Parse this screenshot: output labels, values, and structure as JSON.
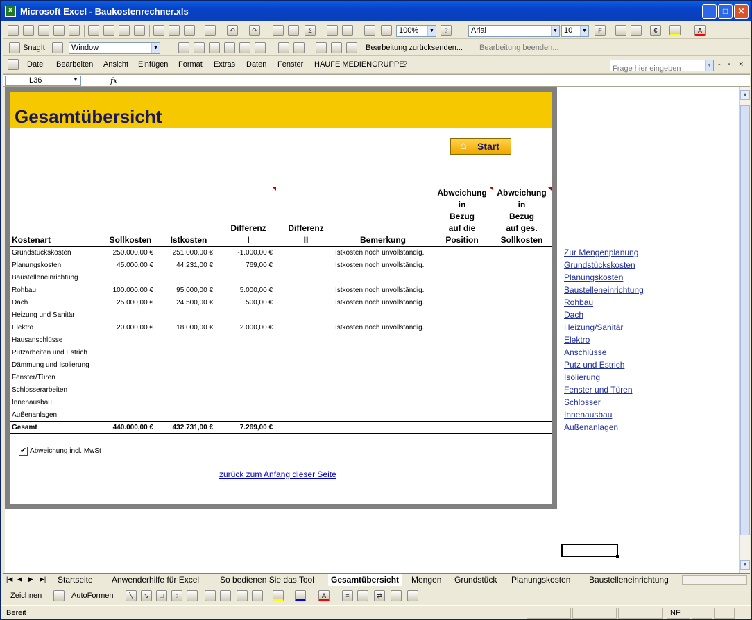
{
  "window": {
    "title": "Microsoft Excel - Baukostenrechner.xls"
  },
  "toolbar": {
    "zoom": "100%",
    "font": "Arial",
    "font_size": "10",
    "bold": "F",
    "euro": "€",
    "fill_color": "#FFFF00",
    "font_color": "#FF0000"
  },
  "snagit": {
    "label": "SnagIt",
    "window_value": "Window",
    "review_return": "Bearbeitung zurücksenden...",
    "review_end": "Bearbeitung beenden..."
  },
  "menu": {
    "items": [
      "Datei",
      "Bearbeiten",
      "Ansicht",
      "Einfügen",
      "Format",
      "Extras",
      "Daten",
      "Fenster",
      "HAUFE MEDIENGRUPPE",
      "?"
    ],
    "help_placeholder": "Frage hier eingeben"
  },
  "formula": {
    "name_box": "L36",
    "fx": "fx"
  },
  "sheet": {
    "title": "Gesamtübersicht",
    "start_button": "Start",
    "headers": [
      "Kostenart",
      "Sollkosten",
      "Istkosten",
      "Differenz I",
      "Differenz II",
      "Bemerkung",
      "Abweichung in Bezug auf die Position",
      "Abweichung in Bezug auf ges. Sollkosten"
    ],
    "header_lines": [
      [
        "Kostenart"
      ],
      [
        "Sollkosten"
      ],
      [
        "Istkosten"
      ],
      [
        "Differenz",
        "I"
      ],
      [
        "Differenz",
        "II"
      ],
      [
        "Bemerkung"
      ],
      [
        "Abweichung",
        "in",
        "Bezug",
        "auf die",
        "Position"
      ],
      [
        "Abweichung",
        "in",
        "Bezug",
        "auf ges.",
        "Sollkosten"
      ]
    ],
    "rows": [
      [
        "Grundstückskosten",
        "250.000,00 €",
        "251.000,00 €",
        "-1.000,00 €",
        "",
        "Istkosten noch unvollständig.",
        "",
        ""
      ],
      [
        "Planungskosten",
        "45.000,00 €",
        "44.231,00 €",
        "769,00 €",
        "",
        "Istkosten noch unvollständig.",
        "",
        ""
      ],
      [
        "Baustelleneinrichtung",
        "",
        "",
        "",
        "",
        "",
        "",
        ""
      ],
      [
        "Rohbau",
        "100.000,00 €",
        "95.000,00 €",
        "5.000,00 €",
        "",
        "Istkosten noch unvollständig.",
        "",
        ""
      ],
      [
        "Dach",
        "25.000,00 €",
        "24.500,00 €",
        "500,00 €",
        "",
        "Istkosten noch unvollständig.",
        "",
        ""
      ],
      [
        "Heizung und Sanitär",
        "",
        "",
        "",
        "",
        "",
        "",
        ""
      ],
      [
        "Elektro",
        "20.000,00 €",
        "18.000,00 €",
        "2.000,00 €",
        "",
        "Istkosten noch unvollständig.",
        "",
        ""
      ],
      [
        "Hausanschlüsse",
        "",
        "",
        "",
        "",
        "",
        "",
        ""
      ],
      [
        "Putzarbeiten und Estrich",
        "",
        "",
        "",
        "",
        "",
        "",
        ""
      ],
      [
        "Dämmung und Isolierung",
        "",
        "",
        "",
        "",
        "",
        "",
        ""
      ],
      [
        "Fenster/Türen",
        "",
        "",
        "",
        "",
        "",
        "",
        ""
      ],
      [
        "Schlosserarbeiten",
        "",
        "",
        "",
        "",
        "",
        "",
        ""
      ],
      [
        "Innenausbau",
        "",
        "",
        "",
        "",
        "",
        "",
        ""
      ],
      [
        "Außenanlagen",
        "",
        "",
        "",
        "",
        "",
        "",
        ""
      ]
    ],
    "total": [
      "Gesamt",
      "440.000,00 €",
      "432.731,00 €",
      "7.269,00 €",
      "",
      "",
      "",
      ""
    ],
    "checkbox_label": "Abweichung incl. MwSt",
    "checkbox_checked": true,
    "back_link": "zurück zum Anfang dieser Seite",
    "nav_links": [
      "Zur Mengenplanung",
      "Grundstückskosten",
      "Planungskosten",
      "Baustelleneinrichtung",
      "Rohbau",
      "Dach",
      "Heizung/Sanitär",
      "Elektro",
      "Anschlüsse",
      "Putz und Estrich",
      "Isolierung",
      "Fenster und Türen",
      "Schlosser",
      "Innenausbau",
      "Außenanlagen"
    ]
  },
  "tabs": {
    "items": [
      "Startseite",
      "Anwenderhilfe für Excel",
      "So bedienen Sie das Tool",
      "Gesamtübersicht",
      "Mengen",
      "Grundstück",
      "Planungskosten",
      "Baustelleneinrichtung"
    ],
    "active": "Gesamtübersicht"
  },
  "drawing": {
    "draw_label": "Zeichnen",
    "autoshapes_label": "AutoFormen"
  },
  "status": {
    "text": "Bereit",
    "nf": "NF"
  }
}
